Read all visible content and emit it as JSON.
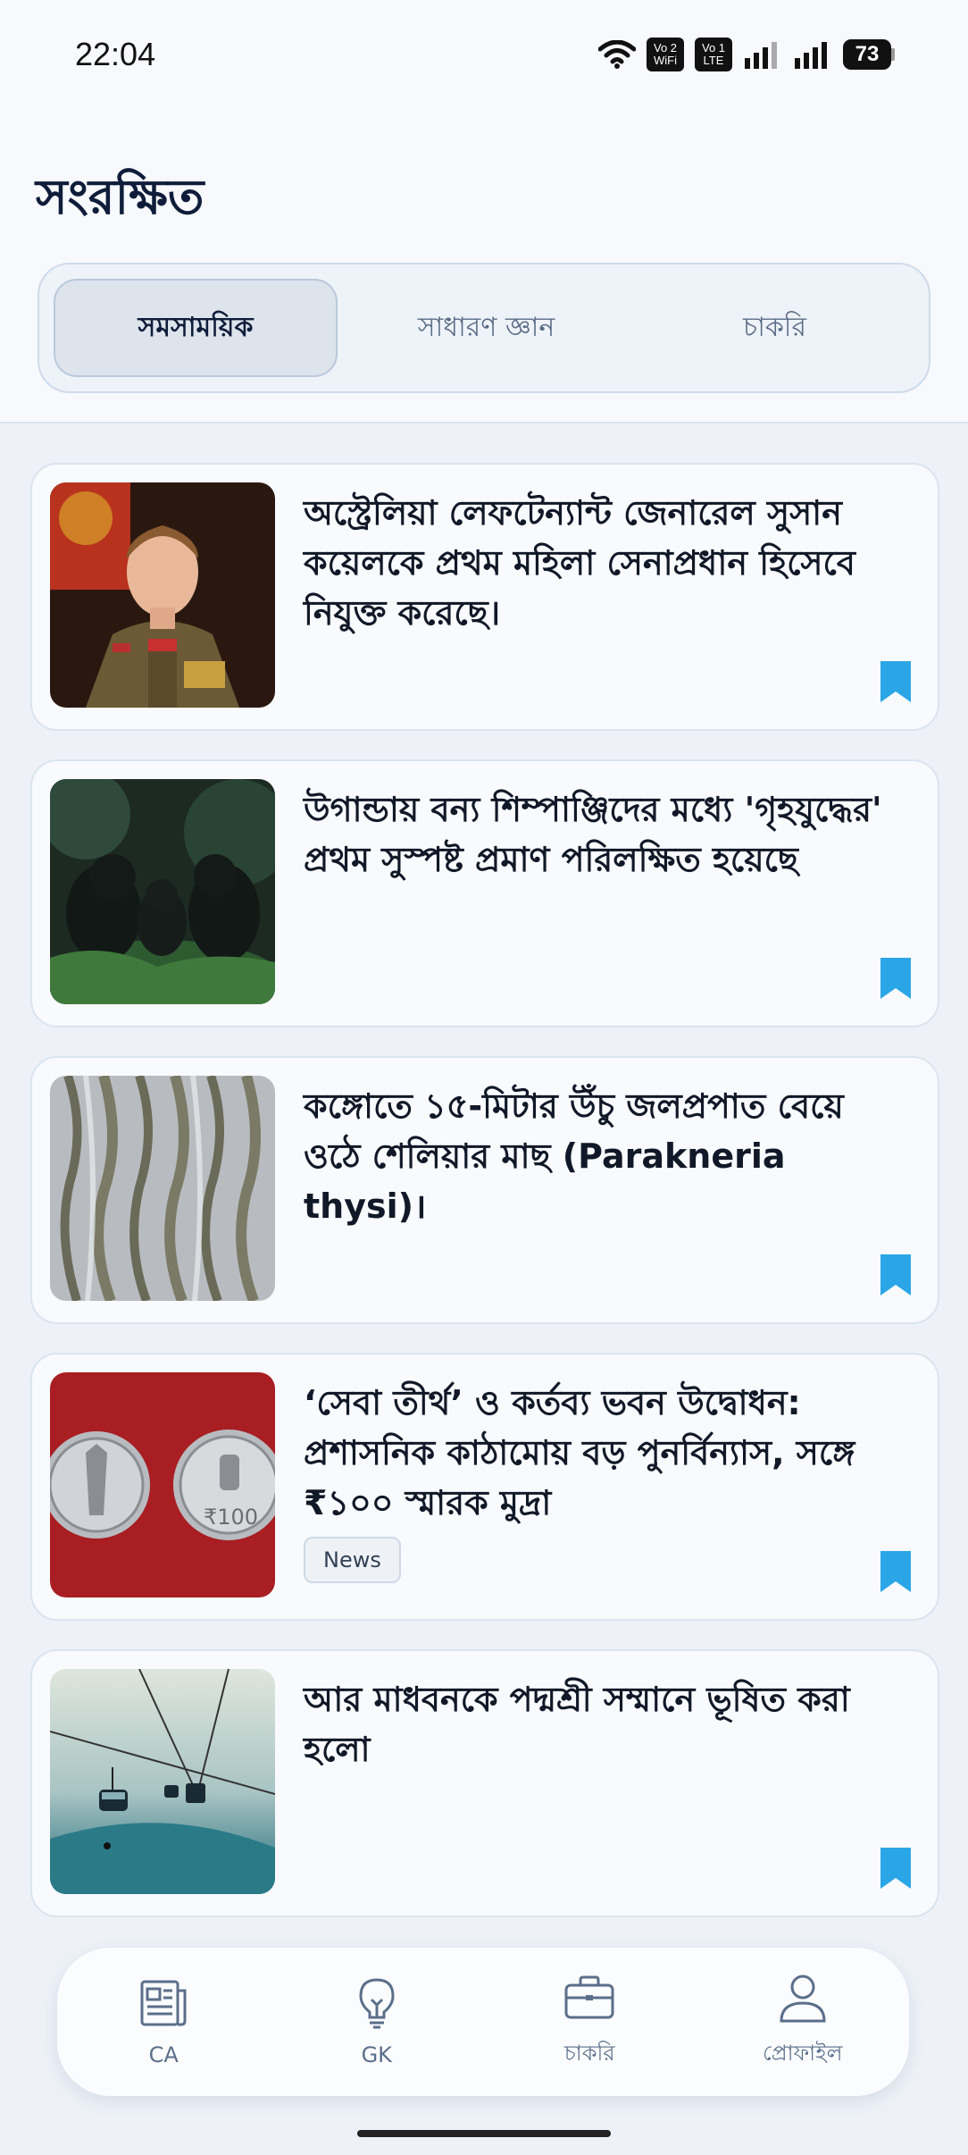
{
  "status": {
    "time": "22:04",
    "sim1_top": "Vo 2",
    "sim1_bottom": "WiFi",
    "sim2_top": "Vo 1",
    "sim2_bottom": "LTE",
    "battery": "73"
  },
  "header": {
    "title": "সংরক্ষিত",
    "tabs": [
      "সমসাময়িক",
      "সাধারণ জ্ঞান",
      "চাকরি"
    ],
    "active_tab": "সমসাময়িক"
  },
  "articles": [
    {
      "title": "অস্ট্রেলিয়া লেফটেন্যান্ট জেনারেল সুসান কয়েলকে প্রথম মহিলা সেনাপ্রধান হিসেবে নিযুক্ত করেছে।",
      "image": "army-officer-portrait",
      "tag": ""
    },
    {
      "title": "উগান্ডায় বন্য শিম্পাঞ্জিদের মধ্যে 'গৃহযুদ্ধের' প্রথম সুস্পষ্ট প্রমাণ পরিলক্ষিত হয়েছে",
      "image": "chimpanzees-forest",
      "tag": ""
    },
    {
      "title": "কঙ্গোতে ১৫-মিটার উঁচু জলপ্রপাত বেয়ে ওঠে শেলিয়ার মাছ (Parakneria thysi)।",
      "image": "fish-waterfall",
      "tag": ""
    },
    {
      "title": "‘সেবা তীর্থ’ ও কর্তব্য ভবন উদ্বোধন: প্রশাসনিক কাঠামোয় বড় পুনর্বিন্যাস, সঙ্গে ₹১০০ স্মারক মুদ্রা",
      "image": "commemorative-coins",
      "tag": "News",
      "coin_value": "₹100"
    },
    {
      "title": "আর মাধবনকে পদ্মশ্রী সম্মানে ভূষিত করা হলো",
      "image": "cable-cars-mountain",
      "tag": ""
    }
  ],
  "nav": [
    {
      "label": "CA",
      "icon": "newspaper-icon"
    },
    {
      "label": "GK",
      "icon": "lightbulb-icon"
    },
    {
      "label": "চাকরি",
      "icon": "briefcase-icon"
    },
    {
      "label": "প্রোফাইল",
      "icon": "user-icon"
    }
  ],
  "colors": {
    "accent": "#2aa6e6",
    "title": "#0f1d3a",
    "background": "#eef2f8"
  }
}
